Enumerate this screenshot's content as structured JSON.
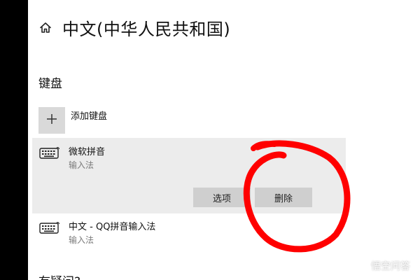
{
  "header": {
    "title": "中文(中华人民共和国)"
  },
  "keyboard_section": {
    "title": "键盘",
    "add_keyboard_label": "添加键盘",
    "keyboards": [
      {
        "name": "微软拼音",
        "type": "输入法",
        "selected": true,
        "options_label": "选项",
        "remove_label": "删除"
      },
      {
        "name": "中文 - QQ拼音输入法",
        "type": "输入法",
        "selected": false
      }
    ]
  },
  "help_section": {
    "title": "有疑问?"
  },
  "annotation": {
    "color": "#ff0000"
  },
  "watermark": {
    "text": "悟空问答"
  },
  "colors": {
    "background_left": "#000000",
    "panel": "#ffffff",
    "selected_card": "#ececec",
    "button": "#cfcfcf",
    "add_box": "#d9d9d9"
  }
}
